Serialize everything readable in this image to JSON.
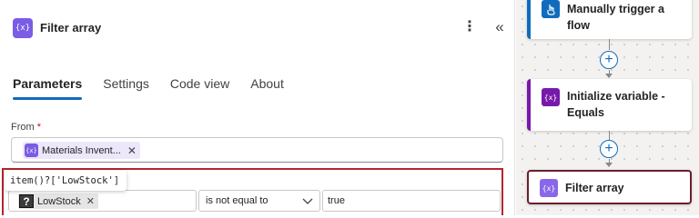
{
  "panel": {
    "title": "Filter array",
    "icon_text": "{x}",
    "more_icon": "more-vertical-icon",
    "collapse_icon": "double-chevron-left-icon",
    "tabs": [
      {
        "label": "Parameters",
        "active": true
      },
      {
        "label": "Settings",
        "active": false
      },
      {
        "label": "Code view",
        "active": false
      },
      {
        "label": "About",
        "active": false
      }
    ]
  },
  "from": {
    "label": "From",
    "required_mark": "*",
    "token": {
      "icon_text": "{x}",
      "label": "Materials Invent...",
      "close": "✕"
    }
  },
  "condition": {
    "tooltip": "item()?['LowStock']",
    "left_chip": {
      "icon_text": "?",
      "label": "LowStock",
      "close": "✕"
    },
    "operator": "is not equal to",
    "right_value": "true"
  },
  "canvas": {
    "nodes": [
      {
        "title_line1": "Manually trigger a",
        "title_line2": "flow",
        "icon": "hand-touch-icon",
        "color": "#0f6cbd"
      },
      {
        "title_line1": "Initialize variable -",
        "title_line2": "Equals",
        "icon_text": "{x}",
        "color": "#7719aa"
      },
      {
        "title_line1": "Filter array",
        "icon_text": "{x}",
        "color": "#8a67e8",
        "selected": true
      }
    ],
    "plus": "+"
  },
  "colors": {
    "accent": "#0f6cbd",
    "filter_icon": "#7b5ce6",
    "variable_icon": "#7719aa",
    "highlight_border": "#b3262d"
  }
}
